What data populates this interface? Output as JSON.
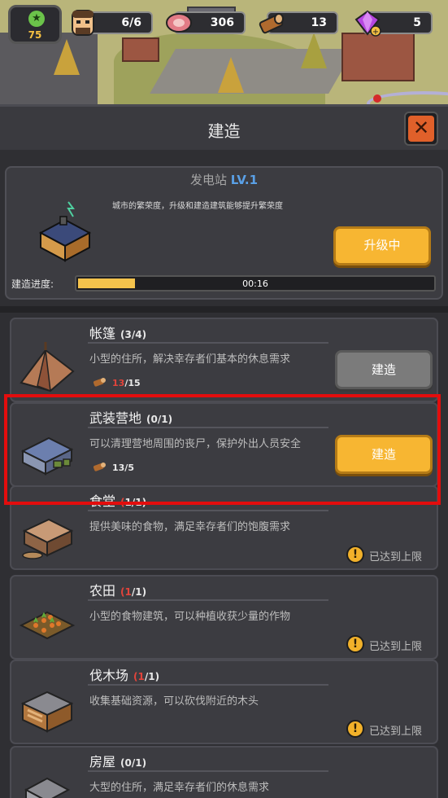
{
  "resources": {
    "level": "75",
    "survivors": "6/6",
    "meat": "306",
    "wood": "13",
    "gems": "5"
  },
  "header": {
    "title": "建造",
    "close_symbol": "✕"
  },
  "station": {
    "name": "发电站",
    "level": "LV.1",
    "description": "城市的繁荣度，升级和建造建筑能够提升繁荣度",
    "upgrade_label": "升级中",
    "progress_label": "建造进度:",
    "progress_time": "00:16",
    "progress_fraction": 0.16
  },
  "buildings": [
    {
      "name": "帐篷",
      "count": "(3/4)",
      "count_red": "",
      "desc": "小型的住所，解决幸存者们基本的休息需求",
      "cost_red": "13",
      "cost_rest": "/15",
      "action": "建造",
      "state": "gray"
    },
    {
      "name": "武装营地",
      "count": "(0/1)",
      "count_red": "",
      "desc": "可以清理营地周围的丧尸，保护外出人员安全",
      "cost_red": "",
      "cost_rest": "13/5",
      "action": "建造",
      "state": "gold"
    },
    {
      "name": "食堂",
      "count": "1/1)",
      "count_red": "(",
      "desc": "提供美味的食物，满足幸存者们的饱腹需求",
      "maxed": "已达到上限",
      "state": "maxed"
    },
    {
      "name": "农田",
      "count": "/1)",
      "count_red": "(1",
      "desc": "小型的食物建筑，可以种植收获少量的作物",
      "maxed": "已达到上限",
      "state": "maxed"
    },
    {
      "name": "伐木场",
      "count": "/1)",
      "count_red": "(1",
      "desc": "收集基础资源，可以砍伐附近的木头",
      "maxed": "已达到上限",
      "state": "maxed"
    },
    {
      "name": "房屋",
      "count": "(0/1)",
      "count_red": "",
      "desc": "大型的住所，满足幸存者们的休息需求",
      "state": "partial"
    }
  ],
  "icons": {
    "level": "star-icon",
    "survivors": "survivor-face-icon",
    "meat": "meat-icon",
    "wood": "wood-log-icon",
    "gems": "gem-icon",
    "warning": "warning-icon"
  },
  "colors": {
    "accent_gold": "#f7b632",
    "highlight_red": "#e30d0d",
    "level_blue": "#5aa0e6"
  }
}
